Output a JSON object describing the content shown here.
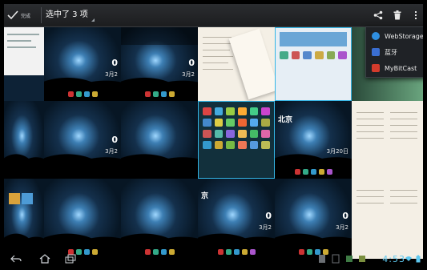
{
  "action_bar": {
    "done_label": "完成",
    "selection_count": "选中了 3 项",
    "share_icon": "share-icon",
    "delete_icon": "trash-icon",
    "overflow_icon": "overflow-menu-icon"
  },
  "share_menu": {
    "items": [
      {
        "label": "WebStorage",
        "icon": "webstorage-icon",
        "color": "#2f8fe0"
      },
      {
        "label": "蓝牙",
        "icon": "bluetooth-icon",
        "color": "#3a6ed1"
      },
      {
        "label": "MyBitCast",
        "icon": "mybitcast-icon",
        "color": "#d33b2c"
      }
    ]
  },
  "thumbnails": {
    "clock_text": "0",
    "date_text": "3月2",
    "city_text": "北京",
    "city_text_2": "京",
    "date_text_2": "3月20日",
    "selected_count": 3
  },
  "system_bar": {
    "time": "4:53",
    "accent": "#33b5e5"
  },
  "colors": {
    "selection_outline": "#33b5e5",
    "action_bar_bg": "#1c1d1f",
    "menu_bg": "#1f2226"
  }
}
